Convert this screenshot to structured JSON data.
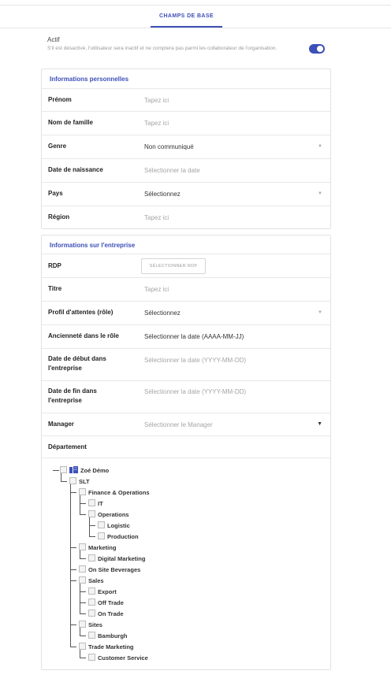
{
  "tabs": {
    "active": "CHAMPS DE BASE"
  },
  "actif": {
    "label": "Actif",
    "description": "S'il est désactivé, l'utilisateur sera inactif et ne comptera pas parmi les collaborateur de l'organisation.",
    "enabled": true
  },
  "personal": {
    "title": "Informations personnelles",
    "rows": [
      {
        "label": "Prénom",
        "value": "Tapez ici"
      },
      {
        "label": "Nom de famille",
        "value": "Tapez ici"
      },
      {
        "label": "Genre",
        "value": "Non communiqué"
      },
      {
        "label": "Date de naissance",
        "value": "Sélectionner la date"
      },
      {
        "label": "Pays",
        "value": "Sélectionnez"
      },
      {
        "label": "Région",
        "value": "Tapez ici"
      }
    ]
  },
  "company": {
    "title": "Informations sur l'entreprise",
    "rdp": {
      "label": "RDP",
      "button": "SÉLECTIONNER RDP"
    },
    "titre": {
      "label": "Titre",
      "value": "Tapez ici"
    },
    "profil": {
      "label": "Profil d'attentes (rôle)",
      "value": "Sélectionnez"
    },
    "anciennete": {
      "label": "Ancienneté dans le rôle",
      "value": "Sélectionner la date (AAAA-MM-JJ)"
    },
    "debut": {
      "label1": "Date de début dans",
      "label2": "l'entreprise",
      "value": "Sélectionner la date (YYYY-MM-DD)"
    },
    "fin": {
      "label1": "Date de fin dans",
      "label2": "l'entreprise",
      "value": "Sélectionner la date (YYYY-MM-DD)"
    },
    "manager": {
      "label": "Manager",
      "value": "Sélectionner le Manager"
    },
    "departement": {
      "label": "Département"
    }
  },
  "tree": [
    "Zoé Démo",
    "SLT",
    "Finance & Operations",
    "IT",
    "Operations",
    "Logistic",
    "Production",
    "Marketing",
    "Digital Marketing",
    "On Site Beverages",
    "Sales",
    "Export",
    "Off Trade",
    "On Trade",
    "Sites",
    "Bamburgh",
    "Trade Marketing",
    "Customer Service"
  ],
  "colors": {
    "accent": "#3d4fb8"
  }
}
